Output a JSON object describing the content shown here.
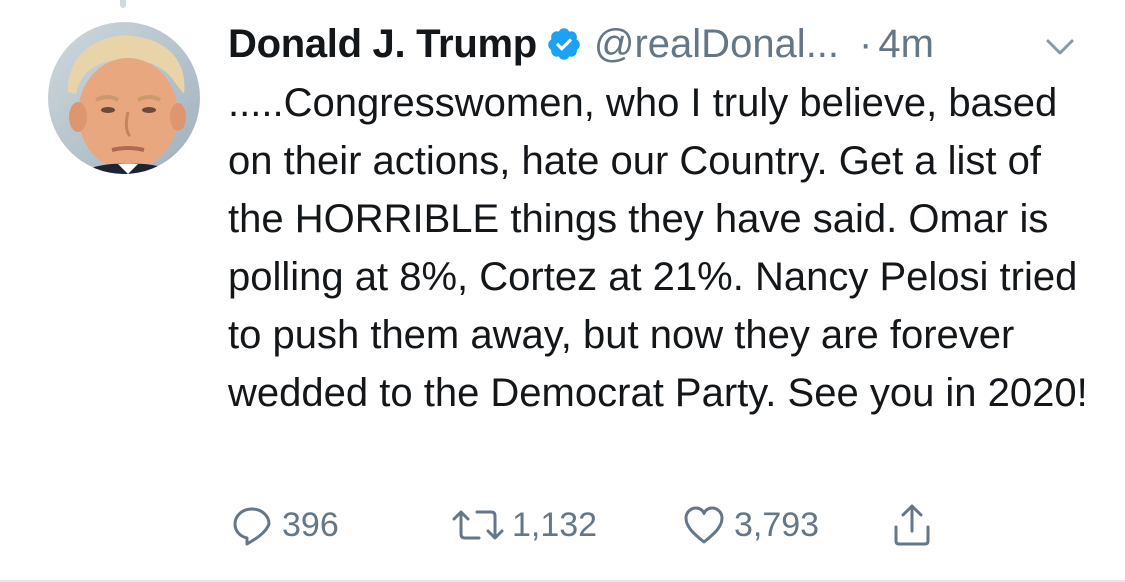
{
  "tweet": {
    "author_name": "Donald J. Trump",
    "handle": "@realDonal...",
    "separator": "·",
    "time": "4m",
    "verified": true,
    "text": ".....Congresswomen, who I truly believe, based on their actions, hate our Country. Get a list of the HORRIBLE things they have said. Omar is polling at 8%, Cortez at 21%. Nancy Pelosi tried to push them away, but now they are forever wedded to the Democrat Party. See you in 2020!",
    "counts": {
      "replies": "396",
      "retweets": "1,132",
      "likes": "3,793"
    }
  },
  "icons": {
    "verified": "verified-badge-icon",
    "caret": "chevron-down-icon",
    "reply": "reply-icon",
    "retweet": "retweet-icon",
    "like": "heart-icon",
    "share": "share-icon"
  },
  "colors": {
    "text": "#14171a",
    "secondary": "#657786",
    "verified": "#1da1f2",
    "divider": "#e1e8ed"
  }
}
